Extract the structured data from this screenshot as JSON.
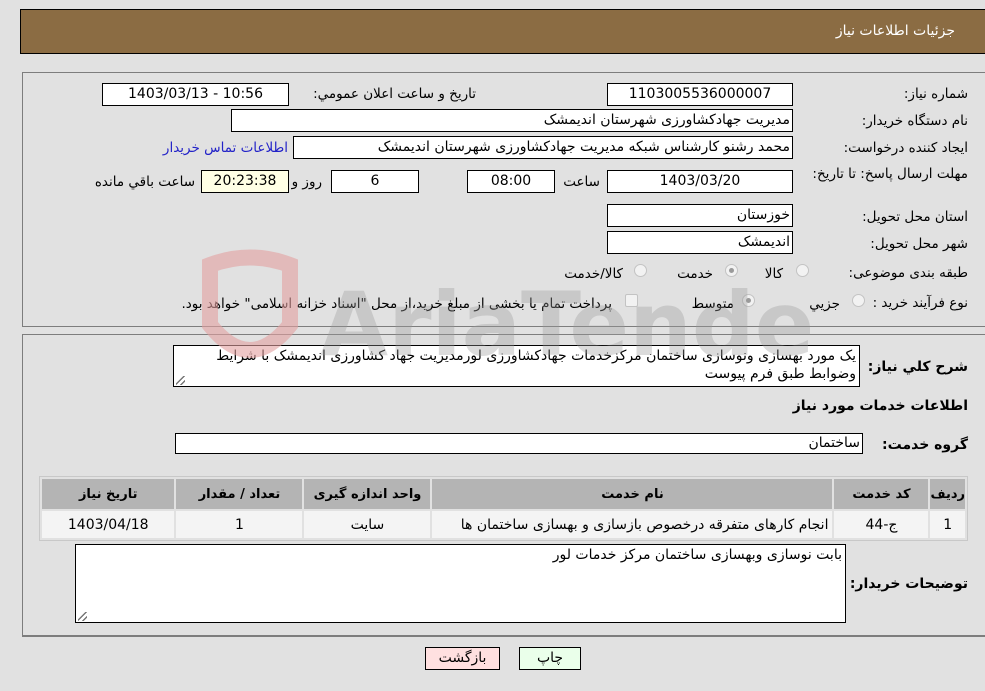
{
  "header": {
    "title": "جزئیات اطلاعات نیاز"
  },
  "form": {
    "need_number": {
      "label": "شماره نیاز:",
      "value": "1103005536000007"
    },
    "announce_datetime": {
      "label": "تاريخ و ساعت اعلان عمومي:",
      "value": "1403/03/13 - 10:56"
    },
    "buyer_org": {
      "label": "نام دستگاه خريدار:",
      "value": "مديريت جهادکشاورزی شهرستان انديمشک"
    },
    "requester": {
      "label": "ايجاد کننده درخواست:",
      "value": "محمد رشنو کارشناس شبکه مديريت جهادکشاورزی شهرستان انديمشک"
    },
    "contact_link": "اطلاعات تماس خريدار",
    "deadline": {
      "label": "مهلت ارسال پاسخ: تا تاریخ:",
      "date": "1403/03/20",
      "time_label": "ساعت",
      "time": "08:00",
      "days": "6",
      "days_label": "روز و",
      "remaining": "20:23:38",
      "remaining_label": "ساعت باقي مانده"
    },
    "province": {
      "label": "استان محل تحويل:",
      "value": "خوزستان"
    },
    "city": {
      "label": "شهر محل تحويل:",
      "value": "انديمشک"
    },
    "category": {
      "label": "طبقه بندی موضوعی:",
      "options": [
        {
          "label": "کالا",
          "checked": false
        },
        {
          "label": "خدمت",
          "checked": true
        },
        {
          "label": "کالا/خدمت",
          "checked": false
        }
      ]
    },
    "process": {
      "label": "نوع فرآيند خريد :",
      "options": [
        {
          "label": "جزيي",
          "checked": false
        },
        {
          "label": "متوسط",
          "checked": true
        }
      ],
      "treasury_checkbox": {
        "label": "پرداخت تمام يا بخشی از مبلغ خريد،از محل \"اسناد خزانه اسلامی\" خواهد بود.",
        "checked": false
      }
    }
  },
  "details": {
    "description_label": "شرح کلي نياز:",
    "description": "يک مورد بهسازی ونوسازی ساختمان مرکزخدمات جهادکشاورزی لورمديريت جهاد کشاورزی انديمشک با شرايط وضوابط طبق فرم پيوست",
    "services_title": "اطلاعات خدمات مورد نياز",
    "service_group_label": "گروه خدمت:",
    "service_group": "ساختمان",
    "table": {
      "headers": [
        "رديف",
        "کد خدمت",
        "نام خدمت",
        "واحد اندازه گيری",
        "تعداد / مقدار",
        "تاريخ نياز"
      ],
      "rows": [
        [
          "1",
          "ج-44",
          "انجام کارهای متفرقه درخصوص بازسازی و بهسازی ساختمان ها",
          "سايت",
          "1",
          "1403/04/18"
        ]
      ]
    },
    "buyer_notes_label": "توضيحات خريدار:",
    "buyer_notes": "بابت نوسازی وبهسازی ساختمان مرکز خدمات لور"
  },
  "buttons": {
    "print": "چاپ",
    "back": "بازگشت"
  },
  "watermark": "AriaTender.neT",
  "colors": {
    "header_bg": "#8b6c43",
    "print_bg": "#eaffea",
    "back_bg": "#ffe0e0",
    "link": "#2323c8"
  }
}
